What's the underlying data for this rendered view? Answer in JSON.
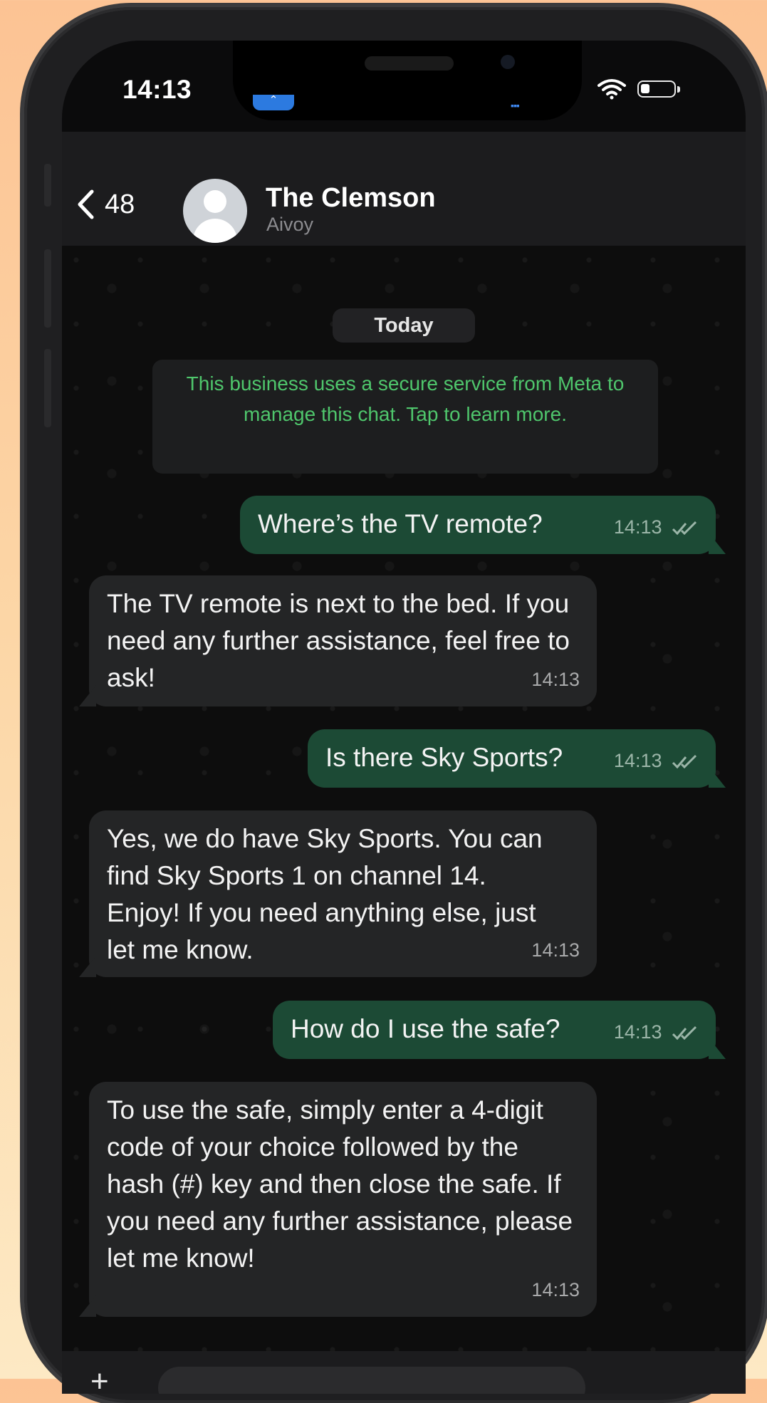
{
  "status_bar": {
    "time": "14:13"
  },
  "header": {
    "back_count": "48",
    "title": "The Clemson",
    "subtitle": "Aivoy"
  },
  "chat": {
    "date_label": "Today",
    "notice": "This business uses a secure service from Meta to manage this chat. Tap to learn more.",
    "messages": [
      {
        "direction": "out",
        "text": "Where’s the TV remote?",
        "time": "14:13"
      },
      {
        "direction": "in",
        "text": "The TV remote is next to the bed. If you need any further assistance, feel free to ask!",
        "time": "14:13"
      },
      {
        "direction": "out",
        "text": "Is there Sky Sports?",
        "time": "14:13"
      },
      {
        "direction": "in",
        "text": "Yes, we do have Sky Sports. You can find Sky Sports 1 on channel 14. Enjoy! If you need anything else, just let me know.",
        "time": "14:13"
      },
      {
        "direction": "out",
        "text": "How do I use the safe?",
        "time": "14:13"
      },
      {
        "direction": "in",
        "text": "To use the safe, simply enter a 4-digit code of your choice followed by the hash (#) key and then close the safe. If you need any further assistance, please let me know!",
        "time": "14:13"
      }
    ]
  },
  "colors": {
    "outgoing_bubble": "#1c4a35",
    "incoming_bubble": "#242526",
    "notice_text": "#4fc66c",
    "background_gradient_top": "#fcc394"
  }
}
